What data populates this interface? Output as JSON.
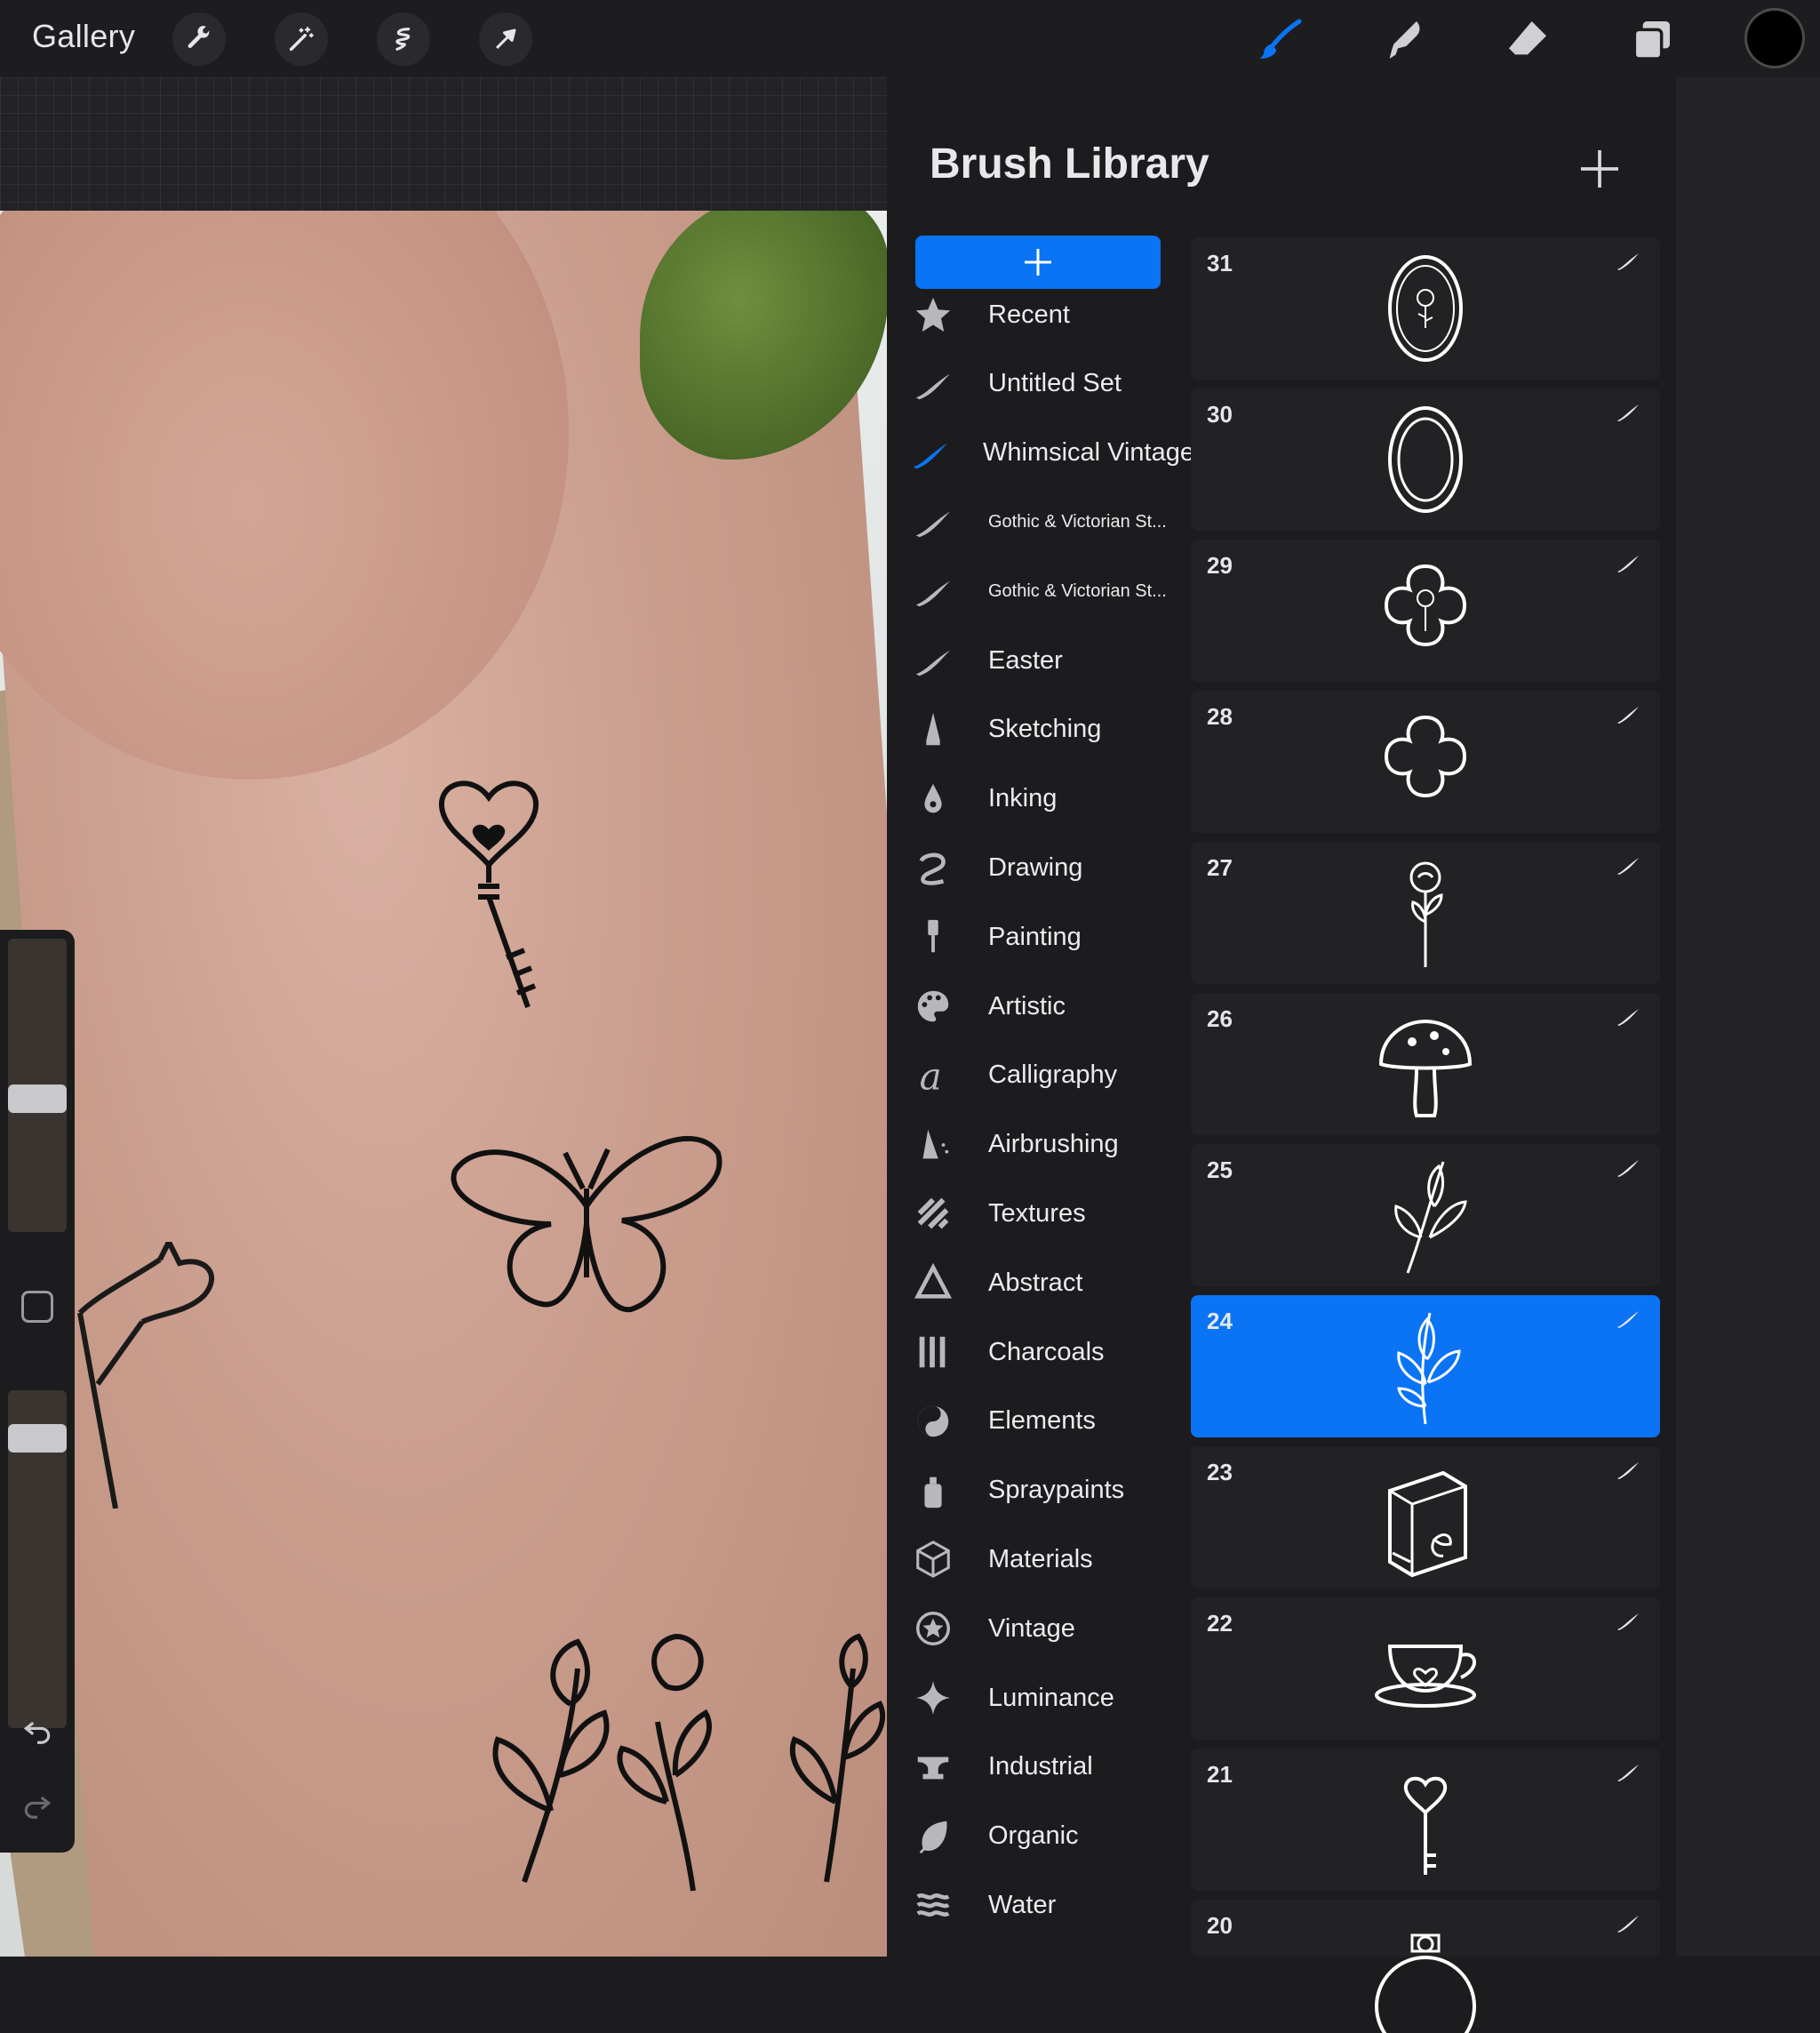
{
  "toolbar": {
    "gallery_label": "Gallery",
    "actions": [
      "wrench-icon",
      "magic-wand-icon",
      "adjustments-icon",
      "selection-arrow-icon"
    ],
    "tools": [
      "brush-icon",
      "smudge-icon",
      "eraser-icon",
      "layers-icon"
    ],
    "active_tool": "brush",
    "current_color": "#000000",
    "accent_color": "#0a74f5"
  },
  "brush_library": {
    "title": "Brush Library",
    "categories": [
      {
        "label": "Recent",
        "icon": "star-icon"
      },
      {
        "label": "Untitled Set",
        "icon": "stroke-icon"
      },
      {
        "label": "Whimsical Vintage",
        "icon": "stroke-icon",
        "active": true
      },
      {
        "label": "Gothic & Victorian St...",
        "icon": "stroke-icon"
      },
      {
        "label": "Gothic & Victorian St...",
        "icon": "stroke-icon"
      },
      {
        "label": "Easter",
        "icon": "stroke-icon"
      },
      {
        "label": "Sketching",
        "icon": "pencil-icon"
      },
      {
        "label": "Inking",
        "icon": "ink-drop-icon"
      },
      {
        "label": "Drawing",
        "icon": "loop-icon"
      },
      {
        "label": "Painting",
        "icon": "paint-brush-icon"
      },
      {
        "label": "Artistic",
        "icon": "palette-icon"
      },
      {
        "label": "Calligraphy",
        "icon": "calligraphy-icon"
      },
      {
        "label": "Airbrushing",
        "icon": "airbrush-icon"
      },
      {
        "label": "Textures",
        "icon": "texture-icon"
      },
      {
        "label": "Abstract",
        "icon": "triangle-icon"
      },
      {
        "label": "Charcoals",
        "icon": "charcoal-icon"
      },
      {
        "label": "Elements",
        "icon": "yin-yang-icon"
      },
      {
        "label": "Spraypaints",
        "icon": "spray-can-icon"
      },
      {
        "label": "Materials",
        "icon": "cube-icon"
      },
      {
        "label": "Vintage",
        "icon": "vintage-star-icon"
      },
      {
        "label": "Luminance",
        "icon": "sparkle-icon"
      },
      {
        "label": "Industrial",
        "icon": "anvil-icon"
      },
      {
        "label": "Organic",
        "icon": "leaf-icon"
      },
      {
        "label": "Water",
        "icon": "waves-icon"
      }
    ],
    "brushes": [
      {
        "number": "31",
        "preview": "rose-frame-icon"
      },
      {
        "number": "30",
        "preview": "oval-frame-icon"
      },
      {
        "number": "29",
        "preview": "quatrefoil-rose-icon"
      },
      {
        "number": "28",
        "preview": "quatrefoil-icon"
      },
      {
        "number": "27",
        "preview": "rose-icon"
      },
      {
        "number": "26",
        "preview": "mushroom-icon"
      },
      {
        "number": "25",
        "preview": "sprig-icon"
      },
      {
        "number": "24",
        "preview": "leaf-sprig-icon",
        "selected": true
      },
      {
        "number": "23",
        "preview": "book-icon"
      },
      {
        "number": "22",
        "preview": "teacup-icon"
      },
      {
        "number": "21",
        "preview": "key-icon"
      },
      {
        "number": "20",
        "preview": "pocket-watch-icon"
      }
    ]
  },
  "sidebar_sliders": {
    "brush_size": 0.45,
    "opacity": 0.89
  }
}
